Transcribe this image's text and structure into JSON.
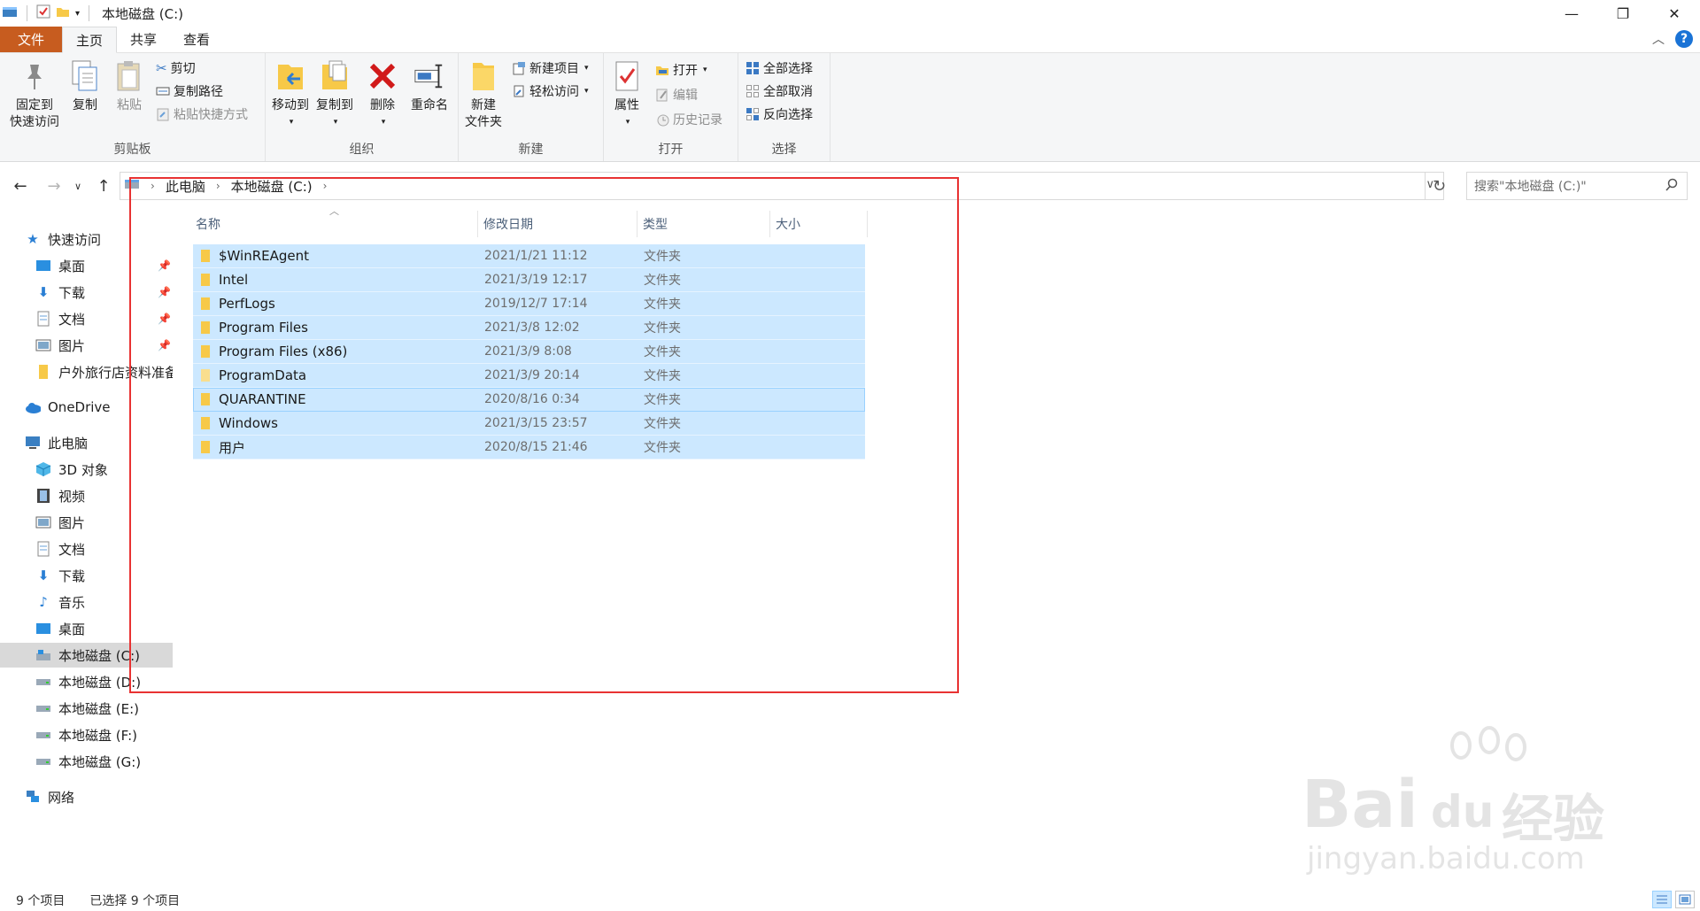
{
  "window": {
    "title": "本地磁盘 (C:)",
    "controls": {
      "minimize": "—",
      "maximize": "❐",
      "close": "✕"
    }
  },
  "ribbon_tabs": [
    {
      "label": "文件"
    },
    {
      "label": "主页"
    },
    {
      "label": "共享"
    },
    {
      "label": "查看"
    }
  ],
  "ribbon": {
    "clipboard": {
      "label": "剪贴板",
      "pin": "固定到\n快速访问",
      "copy": "复制",
      "paste": "粘贴",
      "cut": "剪切",
      "copy_path": "复制路径",
      "paste_shortcut": "粘贴快捷方式"
    },
    "organize": {
      "label": "组织",
      "move_to": "移动到",
      "copy_to": "复制到",
      "delete": "删除",
      "rename": "重命名"
    },
    "new": {
      "label": "新建",
      "new_folder": "新建\n文件夹",
      "new_item": "新建项目",
      "easy_access": "轻松访问"
    },
    "open": {
      "label": "打开",
      "properties": "属性",
      "open": "打开",
      "edit": "编辑",
      "history": "历史记录"
    },
    "select": {
      "label": "选择",
      "select_all": "全部选择",
      "select_none": "全部取消",
      "invert": "反向选择"
    }
  },
  "address": {
    "crumbs": [
      "此电脑",
      "本地磁盘 (C:)"
    ],
    "search_placeholder": "搜索\"本地磁盘 (C:)\""
  },
  "nav_pane": {
    "quick_access": "快速访问",
    "quick_items": [
      "桌面",
      "下载",
      "文档",
      "图片",
      "户外旅行店资料准备"
    ],
    "onedrive": "OneDrive",
    "this_pc": "此电脑",
    "pc_items": [
      "3D 对象",
      "视频",
      "图片",
      "文档",
      "下载",
      "音乐",
      "桌面",
      "本地磁盘 (C:)",
      "本地磁盘 (D:)",
      "本地磁盘 (E:)",
      "本地磁盘 (F:)",
      "本地磁盘 (G:)"
    ],
    "network": "网络"
  },
  "columns": {
    "name": "名称",
    "date": "修改日期",
    "type": "类型",
    "size": "大小"
  },
  "files": [
    {
      "name": "$WinREAgent",
      "date": "2021/1/21 11:12",
      "type": "文件夹"
    },
    {
      "name": "Intel",
      "date": "2021/3/19 12:17",
      "type": "文件夹"
    },
    {
      "name": "PerfLogs",
      "date": "2019/12/7 17:14",
      "type": "文件夹"
    },
    {
      "name": "Program Files",
      "date": "2021/3/8 12:02",
      "type": "文件夹"
    },
    {
      "name": "Program Files (x86)",
      "date": "2021/3/9 8:08",
      "type": "文件夹"
    },
    {
      "name": "ProgramData",
      "date": "2021/3/9 20:14",
      "type": "文件夹"
    },
    {
      "name": "QUARANTINE",
      "date": "2020/8/16 0:34",
      "type": "文件夹"
    },
    {
      "name": "Windows",
      "date": "2021/3/15 23:57",
      "type": "文件夹"
    },
    {
      "name": "用户",
      "date": "2020/8/15 21:46",
      "type": "文件夹"
    }
  ],
  "status": {
    "count": "9 个项目",
    "selected": "已选择 9 个项目"
  },
  "watermark": {
    "brand": "Bai",
    "brand2": "du",
    "cn": "经验",
    "url": "jingyan.baidu.com"
  },
  "colors": {
    "file_tab": "#c75c1f",
    "selection": "#cce8ff",
    "highlight_box": "#e83232",
    "accent": "#1a73d6"
  }
}
